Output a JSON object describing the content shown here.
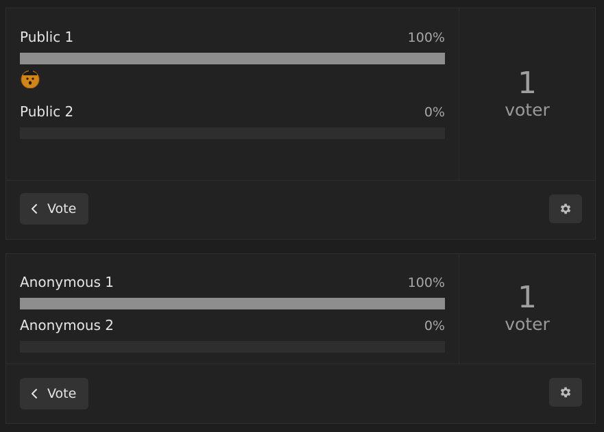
{
  "polls": [
    {
      "id": "public",
      "options": [
        {
          "label": "Public 1",
          "percent_text": "100%",
          "fraction": 1.0,
          "has_voter_avatar": true
        },
        {
          "label": "Public 2",
          "percent_text": "0%",
          "fraction": 0.0,
          "has_voter_avatar": false
        }
      ],
      "voter_count": "1",
      "voter_label": "voter",
      "vote_button_label": "Vote",
      "vote_button_icon": "chevron-left-icon",
      "settings_icon": "gear-icon"
    },
    {
      "id": "anonymous",
      "options": [
        {
          "label": "Anonymous 1",
          "percent_text": "100%",
          "fraction": 1.0
        },
        {
          "label": "Anonymous 2",
          "percent_text": "0%",
          "fraction": 0.0
        }
      ],
      "voter_count": "1",
      "voter_label": "voter",
      "vote_button_label": "Vote",
      "vote_button_icon": "chevron-left-icon",
      "settings_icon": "gear-icon"
    }
  ],
  "colors": {
    "background": "#1e1e1e",
    "card": "#222222",
    "border": "#2e2e2e",
    "bar_track": "#2e2e2e",
    "bar_fill": "#8e8e8e",
    "button": "#333333"
  }
}
